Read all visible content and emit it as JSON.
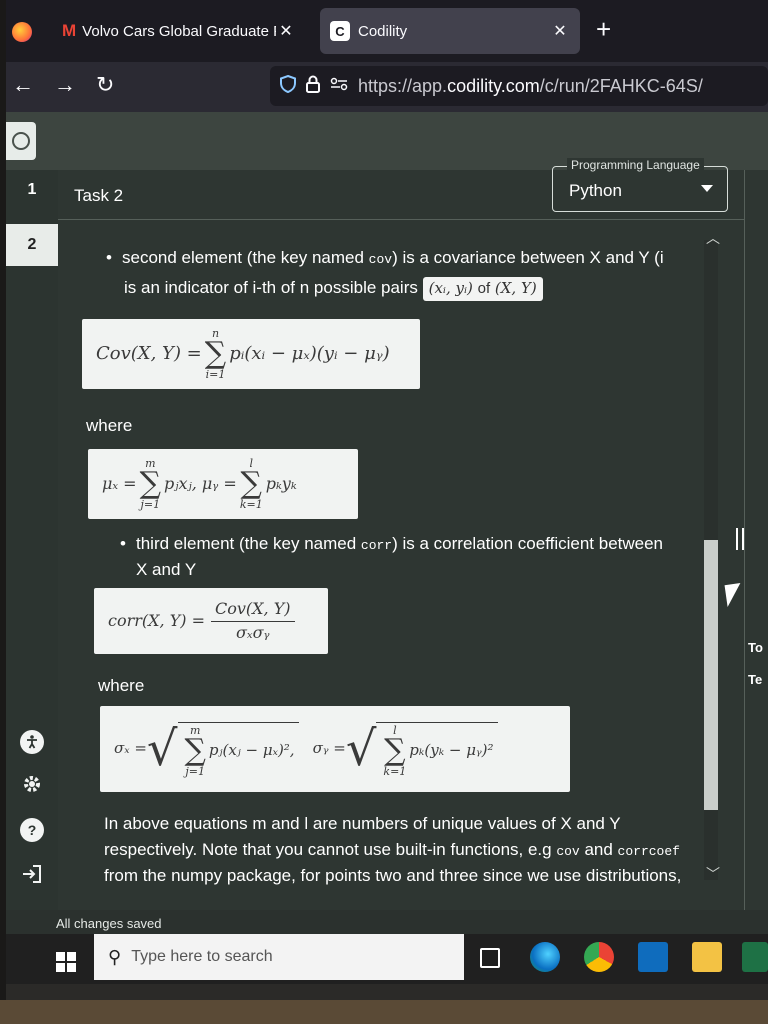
{
  "browser": {
    "tabs": [
      {
        "favicon": "M",
        "title": "Volvo Cars Global Graduate Pro",
        "close": "✕"
      },
      {
        "favicon": "C",
        "title": "Codility",
        "close": "✕"
      }
    ],
    "new_tab": "+",
    "back": "←",
    "forward": "→",
    "reload": "↻",
    "url_prefix": "https://app.",
    "url_domain": "codility.com",
    "url_path": "/c/run/2FAHKC-64S/"
  },
  "sidebar": {
    "task_numbers": [
      "1",
      "2"
    ],
    "icons": [
      "accessibility-icon",
      "gear-icon",
      "help-icon",
      "sign-out-icon"
    ]
  },
  "task": {
    "title": "Task 2",
    "language_label": "Programming Language",
    "language_value": "Python"
  },
  "content": {
    "bullet2_a": "second element (the key named ",
    "bullet2_code": "cov",
    "bullet2_b": ") is a covariance between X and Y (i",
    "bullet2_c": "is an indicator of i-th of n possible pairs",
    "pairs_math": "(xᵢ, yᵢ)",
    "pairs_of": "of",
    "pairs_xy": "(X, Y)",
    "where_1": "where",
    "bullet3_a": "third element (the key named ",
    "bullet3_code": "corr",
    "bullet3_b": ") is a correlation coefficient between",
    "bullet3_c": "X and Y",
    "where_2": "where",
    "para_1": "In above equations m and l are numbers of unique values of X and Y",
    "para_2a": "respectively. Note that you cannot use built-in functions, e.g ",
    "para_2_code1": "cov",
    "para_2_and": " and ",
    "para_2_code2": "corrcoef",
    "para_3": "from the numpy package, for points two and three since we use distributions,"
  },
  "formulas": {
    "cov_lhs": "Cov(X, Y) =",
    "cov_sum_top": "n",
    "cov_sum_bot": "i=1",
    "cov_rhs": "pᵢ(xᵢ − μₓ)(yᵢ − μᵧ)",
    "mu_x_lhs": "μₓ =",
    "mu_x_top": "m",
    "mu_x_bot": "j=1",
    "mu_x_rhs": "pⱼxⱼ,  μᵧ =",
    "mu_y_top": "l",
    "mu_y_bot": "k=1",
    "mu_y_rhs": "pₖyₖ",
    "corr_lhs": "corr(X, Y) =",
    "corr_num": "Cov(X, Y)",
    "corr_den": "σₓσᵧ",
    "sig_x_lhs": "σₓ =",
    "sig_x_top": "m",
    "sig_x_bot": "j=1",
    "sig_x_rhs": "pⱼ(xⱼ − μₓ)²,",
    "sig_y_lhs": "σᵧ =",
    "sig_y_top": "l",
    "sig_y_bot": "k=1",
    "sig_y_rhs": "pₖ(yₖ − μᵧ)²"
  },
  "right_panel": {
    "text_1": "To",
    "text_2": "Te"
  },
  "status": {
    "saved": "All changes saved"
  },
  "taskbar": {
    "search_placeholder": "Type here to search"
  }
}
